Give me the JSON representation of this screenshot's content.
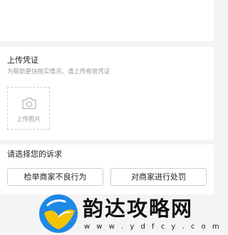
{
  "upload_section": {
    "title": "上传凭证",
    "hint": "为帮助更快核实情况，请上传有效凭证",
    "upload_button_label": "上传图片",
    "upload_icon": "camera-icon"
  },
  "appeal_section": {
    "title": "请选择您的诉求",
    "options": [
      {
        "label": "检举商家不良行为"
      },
      {
        "label": "对商家进行处罚"
      }
    ]
  },
  "watermark": {
    "title": "韵达攻略网",
    "url": "w w w . y d f c y . c o m"
  },
  "colors": {
    "page_bg": "#f4f4f4",
    "card_bg": "#ffffff",
    "text_primary": "#222222",
    "text_hint": "#9a9a9a",
    "border": "#cfcfcf",
    "logo_blue": "#1e88e5",
    "logo_yellow": "#f5c400"
  }
}
